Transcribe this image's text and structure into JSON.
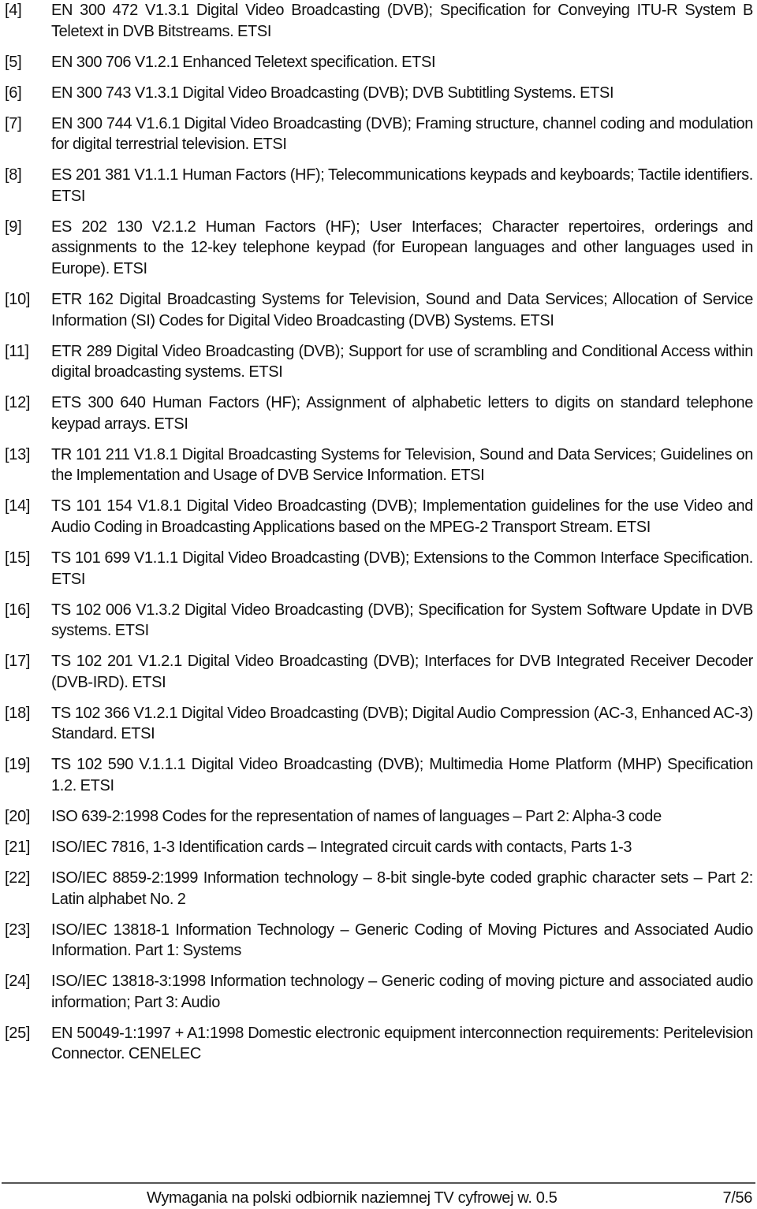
{
  "references": [
    {
      "label": "[4]",
      "text": "EN 300 472 V1.3.1 Digital Video Broadcasting (DVB); Specification for Conveying ITU-R System B Teletext in DVB Bitstreams. ETSI"
    },
    {
      "label": "[5]",
      "text": "EN 300 706 V1.2.1 Enhanced Teletext specification. ETSI"
    },
    {
      "label": "[6]",
      "text": "EN 300 743 V1.3.1 Digital Video Broadcasting (DVB); DVB Subtitling Systems. ETSI"
    },
    {
      "label": "[7]",
      "text": "EN 300 744 V1.6.1 Digital Video Broadcasting (DVB); Framing structure, channel coding and modulation for digital terrestrial television. ETSI"
    },
    {
      "label": "[8]",
      "text": "ES 201 381 V1.1.1 Human Factors (HF); Telecommunications keypads and keyboards; Tactile identifiers. ETSI"
    },
    {
      "label": "[9]",
      "text": "ES 202 130 V2.1.2 Human Factors (HF); User Interfaces; Character repertoires, orderings and assignments to the 12-key telephone keypad (for European languages and other languages used in Europe). ETSI"
    },
    {
      "label": "[10]",
      "text": "ETR 162 Digital Broadcasting Systems for Television, Sound and Data Services; Allocation of Service Information (SI) Codes for Digital Video Broadcasting (DVB) Systems. ETSI"
    },
    {
      "label": "[11]",
      "text": "ETR 289 Digital Video Broadcasting (DVB); Support for use of scrambling and Conditional Access within digital broadcasting systems. ETSI"
    },
    {
      "label": "[12]",
      "text": "ETS 300 640 Human Factors (HF); Assignment of alphabetic letters to digits on standard telephone keypad arrays. ETSI"
    },
    {
      "label": "[13]",
      "text": "TR 101 211 V1.8.1 Digital Broadcasting Systems for Television, Sound and Data Services; Guidelines on the Implementation and Usage of DVB Service Information. ETSI"
    },
    {
      "label": "[14]",
      "text": "TS 101 154 V1.8.1 Digital Video Broadcasting (DVB); Implementation guidelines for the use Video and Audio Coding in Broadcasting Applications based on the MPEG-2 Transport Stream. ETSI"
    },
    {
      "label": "[15]",
      "text": "TS 101 699 V1.1.1 Digital Video Broadcasting (DVB); Extensions to the Common Interface Specification. ETSI"
    },
    {
      "label": "[16]",
      "text": "TS 102 006 V1.3.2 Digital Video Broadcasting (DVB); Specification for System Software Update in DVB systems. ETSI"
    },
    {
      "label": "[17]",
      "text": "TS 102 201 V1.2.1 Digital Video Broadcasting (DVB); Interfaces for DVB Integrated Receiver Decoder (DVB-IRD). ETSI"
    },
    {
      "label": "[18]",
      "text": "TS 102 366 V1.2.1 Digital Video Broadcasting (DVB); Digital Audio Compression (AC-3, Enhanced AC-3) Standard. ETSI"
    },
    {
      "label": "[19]",
      "text": "TS 102 590 V.1.1.1 Digital Video Broadcasting (DVB); Multimedia Home Platform (MHP) Specification 1.2. ETSI"
    },
    {
      "label": "[20]",
      "text": "ISO 639-2:1998 Codes for the representation of names of languages – Part 2: Alpha-3 code"
    },
    {
      "label": "[21]",
      "text": "ISO/IEC 7816, 1-3 Identification cards – Integrated circuit cards with contacts, Parts 1-3"
    },
    {
      "label": "[22]",
      "text": "ISO/IEC 8859-2:1999 Information technology – 8-bit single-byte coded graphic character sets – Part 2: Latin alphabet No. 2"
    },
    {
      "label": "[23]",
      "text": "ISO/IEC 13818-1 Information Technology – Generic Coding of Moving Pictures and Associated Audio Information. Part 1: Systems"
    },
    {
      "label": "[24]",
      "text": "ISO/IEC 13818-3:1998 Information technology – Generic coding of moving picture and associated audio information; Part 3: Audio"
    },
    {
      "label": "[25]",
      "text": "EN 50049-1:1997 + A1:1998 Domestic electronic equipment interconnection requirements: Peritelevision Connector. CENELEC"
    }
  ],
  "footer": {
    "title": "Wymagania na polski odbiornik naziemnej TV cyfrowej w. 0.5",
    "page": "7/56"
  }
}
